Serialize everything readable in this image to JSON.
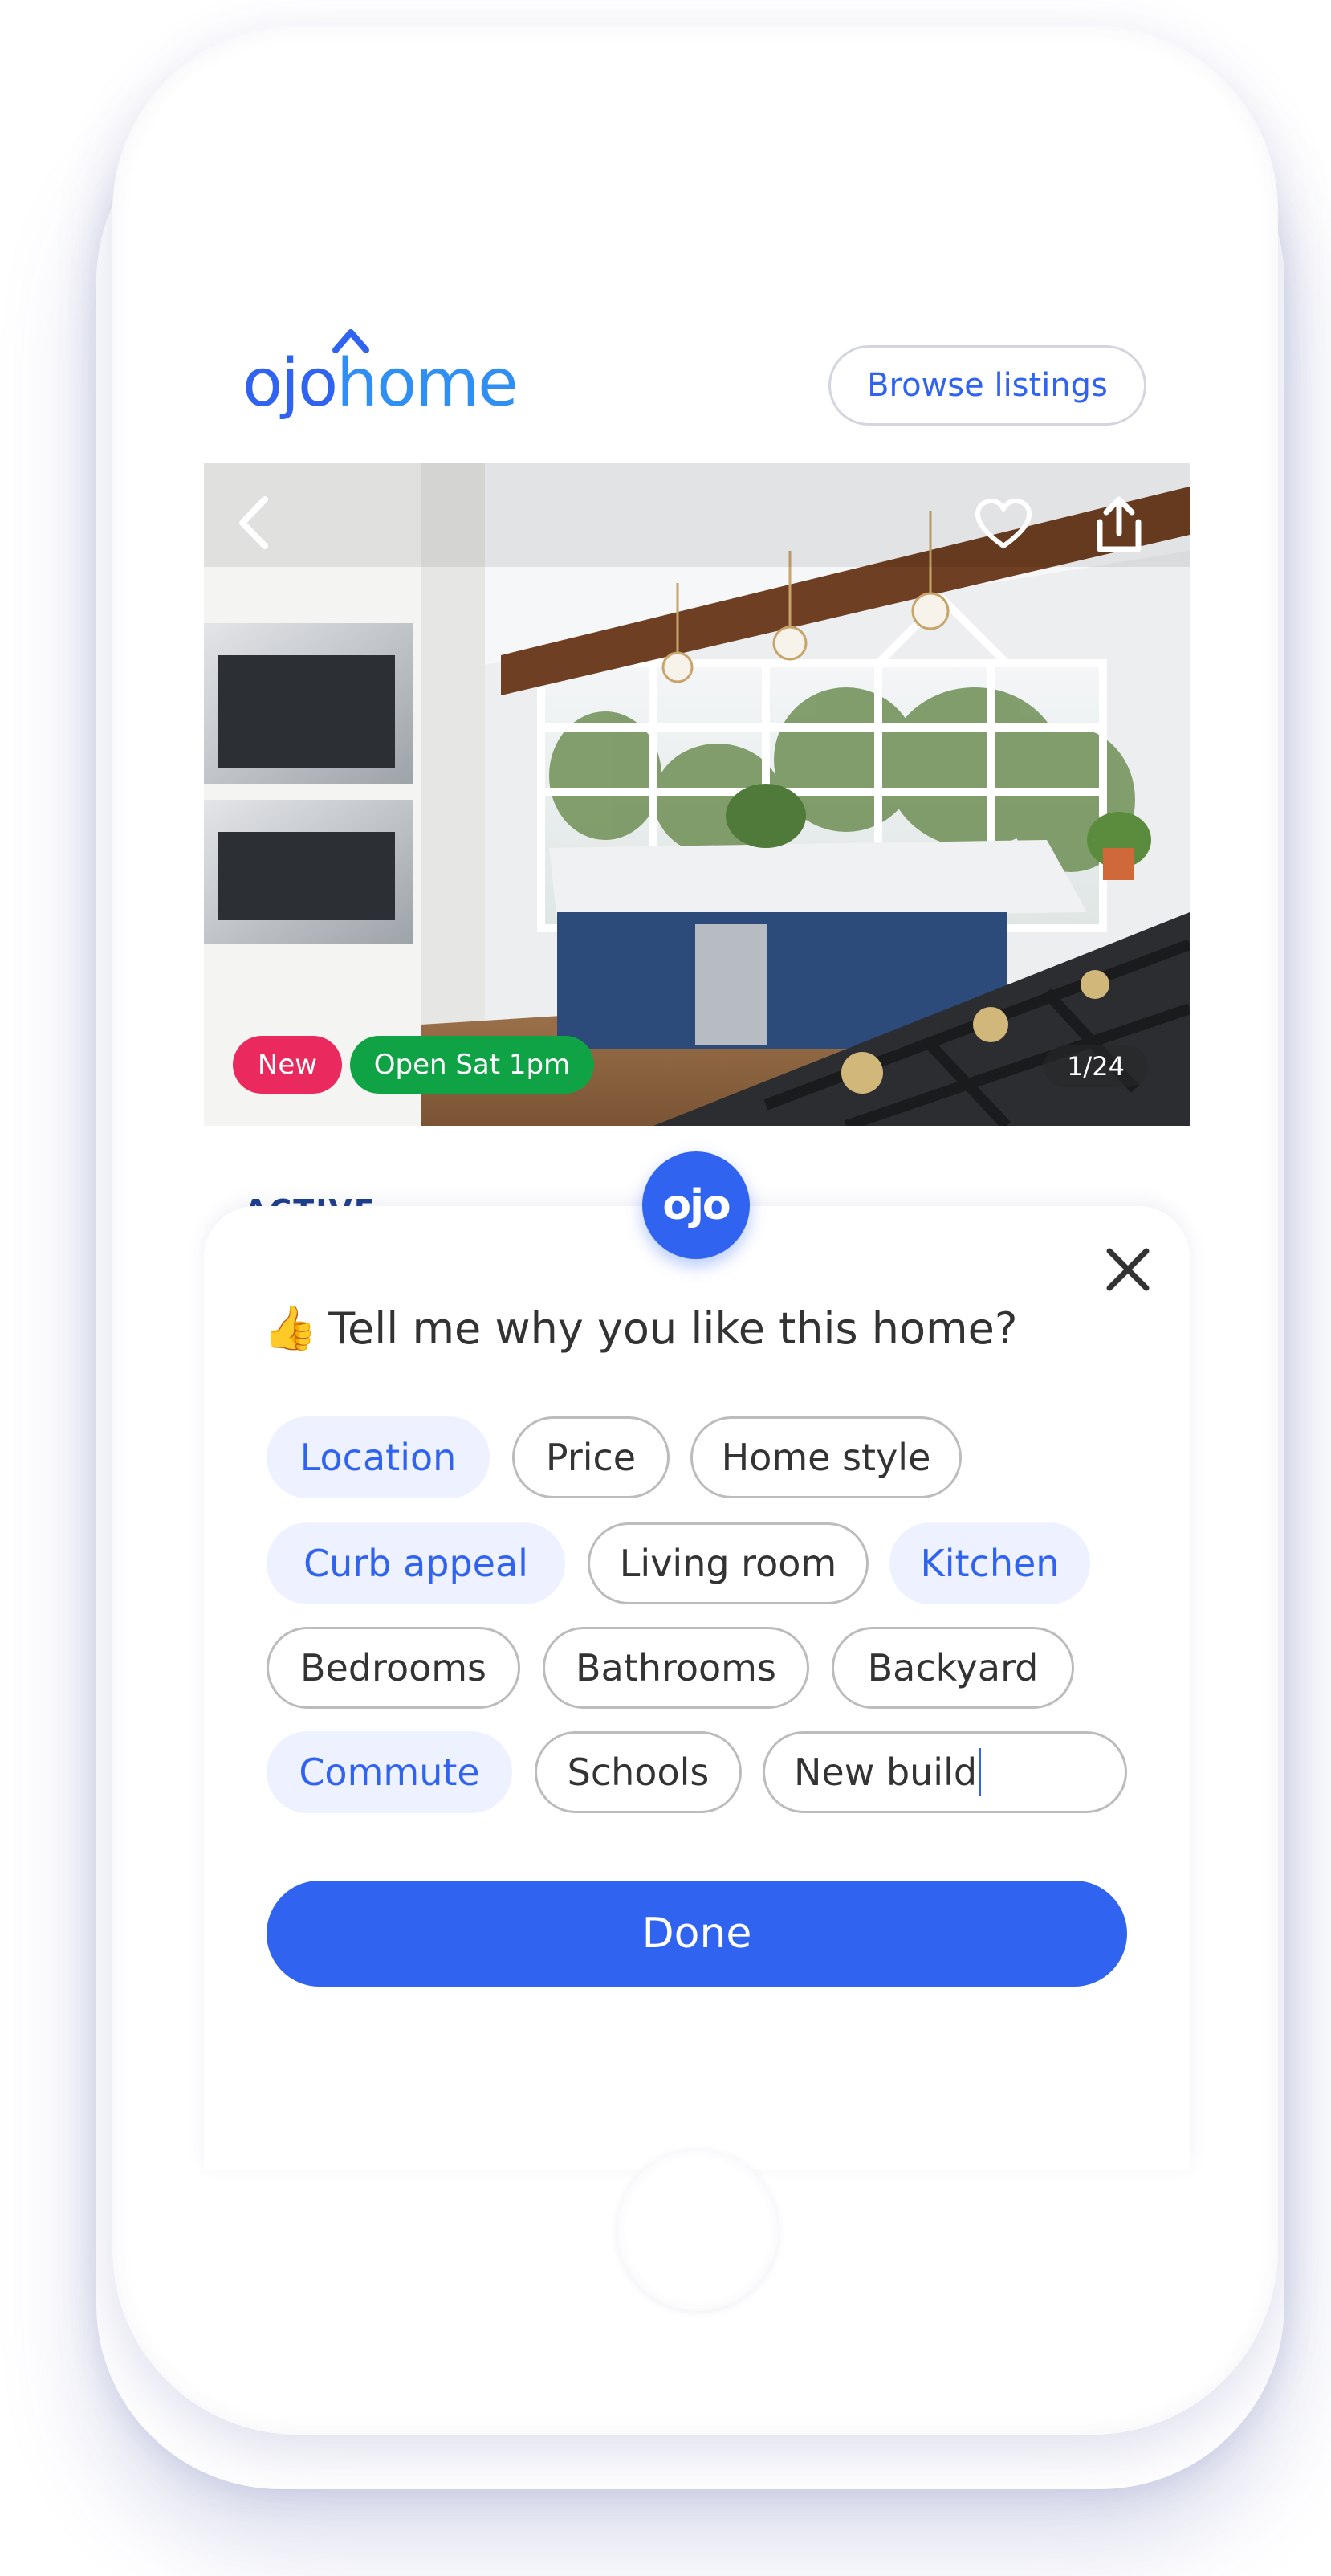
{
  "header": {
    "logo_part1": "oj",
    "logo_part2": "o",
    "logo_part3": "home",
    "browse_label": "Browse listings"
  },
  "photo": {
    "back_icon": "chevron-left-icon",
    "favorite_icon": "heart-icon",
    "share_icon": "share-icon",
    "badge_new": "New",
    "badge_open_house": "Open Sat 1pm",
    "counter": "1/24"
  },
  "listing": {
    "status_peek": "ACTIVE"
  },
  "sheet": {
    "fab_label": "ojo",
    "close_icon": "close-icon",
    "emoji": "👍",
    "question": "Tell me why you like this home?",
    "chips": {
      "location": "Location",
      "price": "Price",
      "home_style": "Home style",
      "curb_appeal": "Curb appeal",
      "living_room": "Living room",
      "kitchen": "Kitchen",
      "bedrooms": "Bedrooms",
      "bathrooms": "Bathrooms",
      "backyard": "Backyard",
      "commute": "Commute",
      "schools": "Schools",
      "custom_input_value": "New build"
    },
    "selected": [
      "Location",
      "Curb appeal",
      "Kitchen",
      "Commute"
    ],
    "done_label": "Done"
  },
  "colors": {
    "accent": "#2f63f0",
    "badge_new": "#ea2a5e",
    "badge_open": "#10a345",
    "chip_selected_bg": "#eef1ff"
  }
}
